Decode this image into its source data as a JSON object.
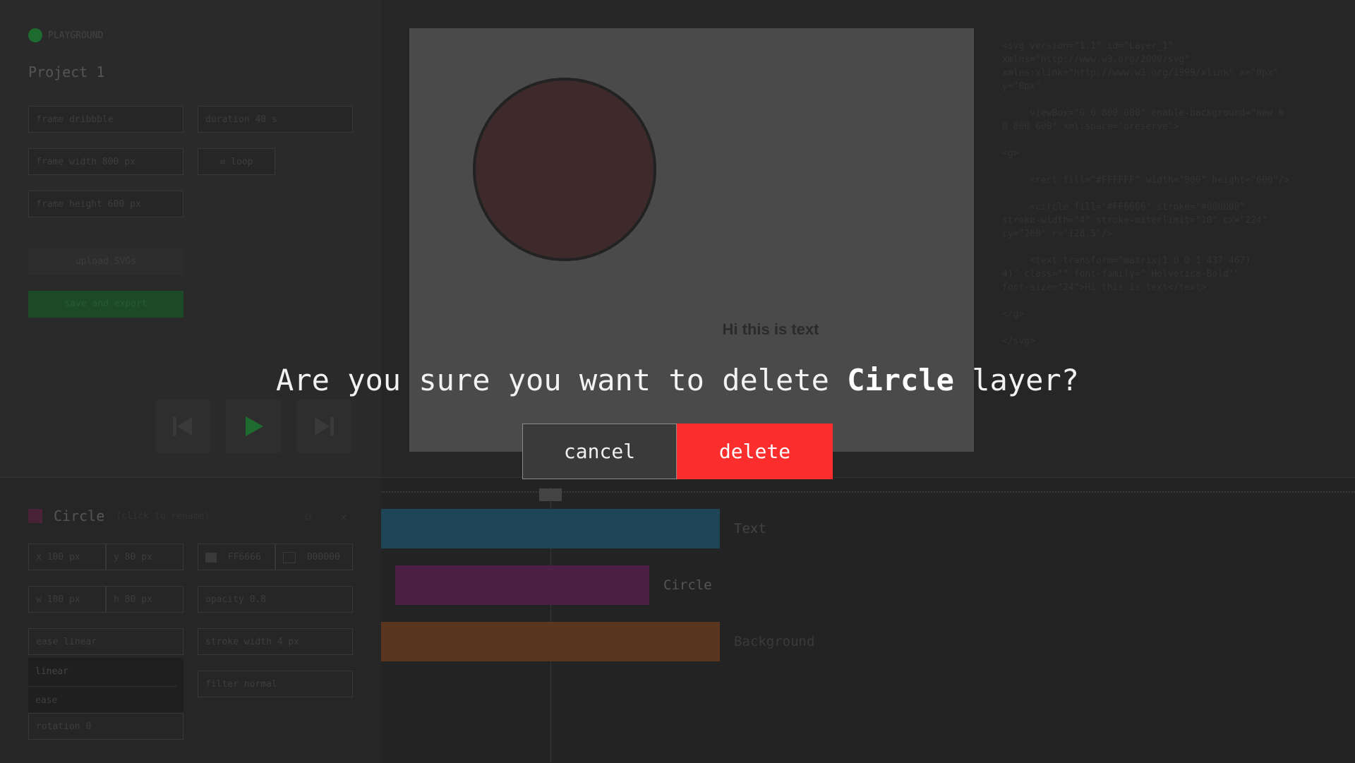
{
  "brand": {
    "name": "PLAYGROUND"
  },
  "project": {
    "title": "Project 1"
  },
  "settings": {
    "frame": "frame  dribbble",
    "duration": "duration  40 s",
    "frame_width": "frame width  800 px",
    "frame_height": "frame height  600 px",
    "loop": "loop",
    "upload": "upload SVGs",
    "save": "save and export"
  },
  "stage": {
    "text": "Hi this is text"
  },
  "code": {
    "lines": "<svg version=\"1.1\" id=\"Layer_1\"\nxmlns=\"http://www.w3.org/2000/svg\"\nxmlns:xlink=\"http://www.w3.org/1999/xlink\" x=\"0px\"\ny=\"0px\"\n\n     viewBox=\"0 0 800 600\" enable-background=\"new 0\n0 800 600\" xml:space=\"preserve\">\n\n<g>\n\n     <rect fill=\"#FFFFFF\" width=\"800\" height=\"600\"/>\n\n     <circle fill=\"#FF6666\" stroke=\"#000000\"\nstroke-width=\"4\" stroke-miterlimit=\"10\" cx=\"224\"\ncy=\"200\" r=\"128.5\"/>\n\n     <text transform=\"matrix(1 0 0 1 437 467)\n4)\" class=\"\" font-family=\"'Helvetica-Bold'\"\nfont-size=\"24\">Hi this is text</text>\n\n</g>\n\n</svg>"
  },
  "layer": {
    "name": "Circle",
    "sub": "(click to rename)",
    "x": "x  100 px",
    "y": "y  80 px",
    "fill": "FF6666",
    "stroke": "000000",
    "w": "w  100 px",
    "h": "h  80 px",
    "opacity": "opacity  0.8",
    "ease": "ease  linear",
    "stroke_width": "stroke width  4 px",
    "ease_options": [
      "linear",
      "ease"
    ],
    "filter": "filter  normal",
    "rotation": "rotation  0"
  },
  "tracks": [
    {
      "label": "Text",
      "color": "#1f4656"
    },
    {
      "label": "Circle",
      "color": "#4c1f44"
    },
    {
      "label": "Background",
      "color": "#5a3520"
    }
  ],
  "dialog": {
    "prefix": "Are you sure you want to delete ",
    "layer": "Circle",
    "suffix": " layer?",
    "cancel": "cancel",
    "delete": "delete"
  }
}
